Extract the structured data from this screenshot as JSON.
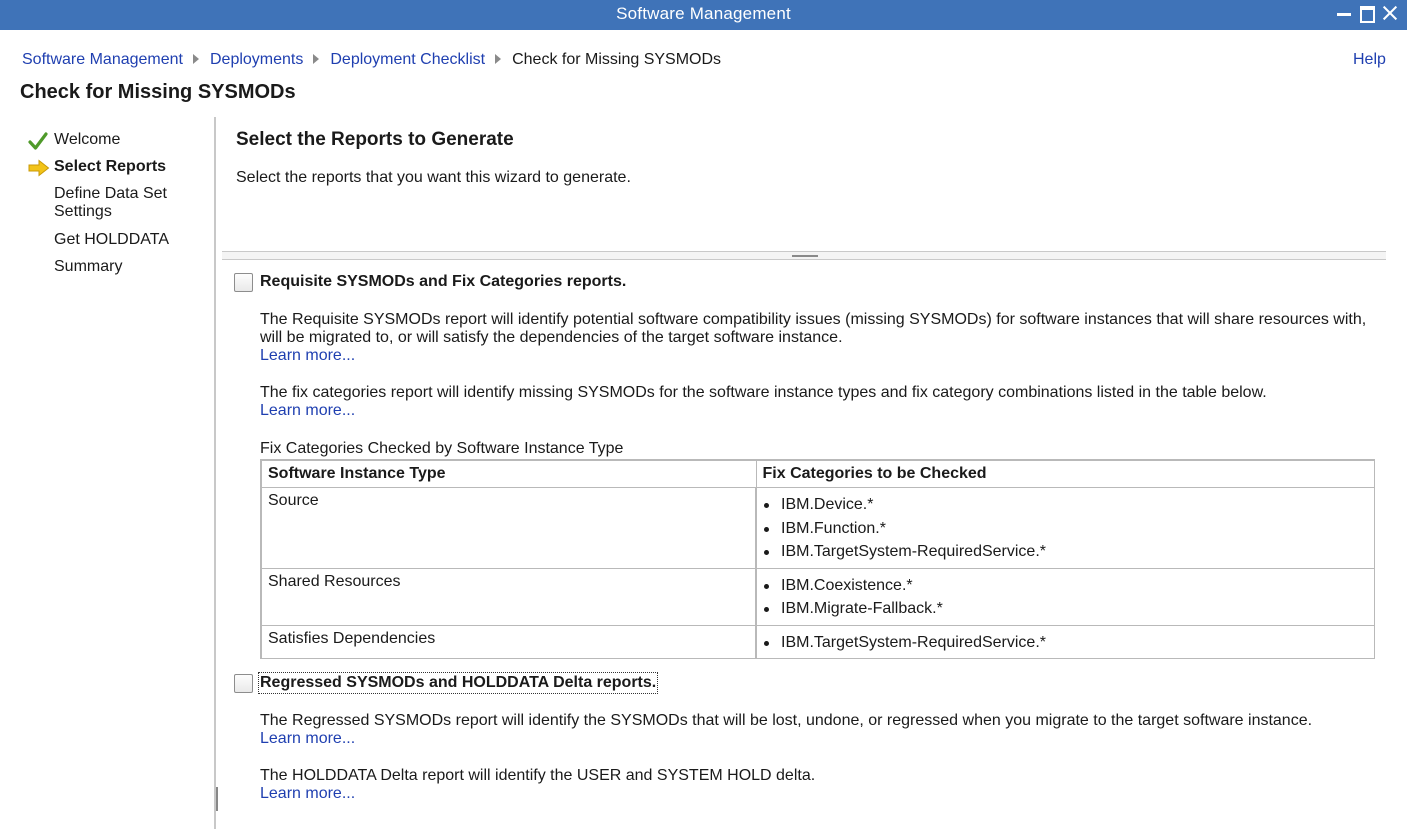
{
  "window": {
    "title": "Software Management"
  },
  "breadcrumb": {
    "items": [
      "Software Management",
      "Deployments",
      "Deployment Checklist"
    ],
    "current": "Check for Missing SYSMODs"
  },
  "help_label": "Help",
  "page_title": "Check for Missing SYSMODs",
  "nav": {
    "items": [
      {
        "label": "Welcome",
        "state": "completed",
        "icon": "check-icon"
      },
      {
        "label": "Select Reports",
        "state": "current",
        "icon": "arrow-right-icon"
      },
      {
        "label": "Define Data Set Settings",
        "line1": "Define Data Set",
        "line2": "Settings",
        "state": "pending"
      },
      {
        "label": "Get HOLDDATA",
        "state": "pending"
      },
      {
        "label": "Summary",
        "state": "pending"
      }
    ]
  },
  "section": {
    "title": "Select the Reports to Generate",
    "description": "Select the reports that you want this wizard to generate."
  },
  "report1": {
    "label": "Requisite SYSMODs and Fix Categories reports.",
    "checked": false,
    "para1": "The Requisite SYSMODs report will identify potential software compatibility issues (missing SYSMODs) for software instances that will share resources with, will be migrated to, or will satisfy the dependencies of the target software instance.",
    "learn1": "Learn more...",
    "para2": "The fix categories report will identify missing SYSMODs for the software instance types and fix category combinations listed in the table below.",
    "learn2": "Learn more...",
    "table_caption": "Fix Categories Checked by Software Instance Type",
    "table": {
      "headers": [
        "Software Instance Type",
        "Fix Categories to be Checked"
      ],
      "rows": [
        {
          "type": "Source",
          "categories": [
            "IBM.Device.*",
            "IBM.Function.*",
            "IBM.TargetSystem-RequiredService.*"
          ]
        },
        {
          "type": "Shared Resources",
          "categories": [
            "IBM.Coexistence.*",
            "IBM.Migrate-Fallback.*"
          ]
        },
        {
          "type": "Satisfies Dependencies",
          "categories": [
            "IBM.TargetSystem-RequiredService.*"
          ]
        }
      ]
    }
  },
  "report2": {
    "label": "Regressed SYSMODs and HOLDDATA Delta reports.",
    "checked": false,
    "para1": "The Regressed SYSMODs report will identify the SYSMODs that will be lost, undone, or regressed when you migrate to the target software instance.",
    "learn1": "Learn more...",
    "para2": "The HOLDDATA Delta report will identify the USER and SYSTEM HOLD delta.",
    "learn2": "Learn more..."
  },
  "colors": {
    "titlebar": "#3f73b8",
    "link": "#1f3fb0",
    "check": "#4f9a2a",
    "arrow": "#f2c318"
  }
}
